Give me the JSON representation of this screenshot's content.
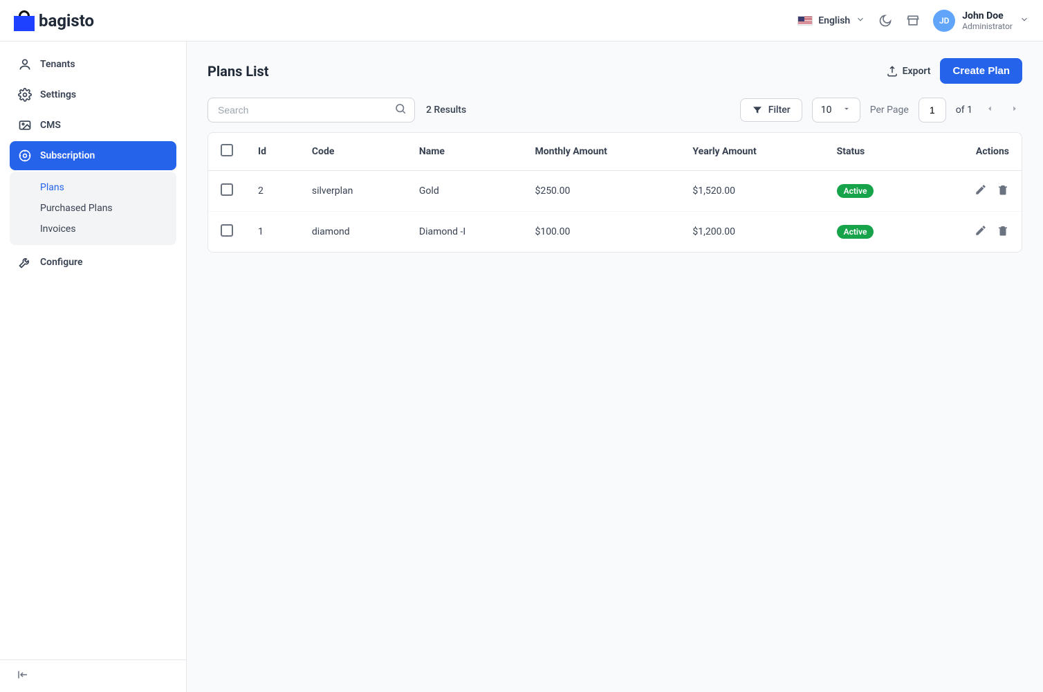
{
  "brand": "bagisto",
  "header": {
    "language": "English",
    "avatar_initials": "JD",
    "user_name": "John Doe",
    "user_role": "Administrator"
  },
  "sidebar": {
    "items": [
      {
        "label": "Tenants"
      },
      {
        "label": "Settings"
      },
      {
        "label": "CMS"
      },
      {
        "label": "Subscription"
      },
      {
        "label": "Configure"
      }
    ],
    "sub": [
      {
        "label": "Plans"
      },
      {
        "label": "Purchased Plans"
      },
      {
        "label": "Invoices"
      }
    ]
  },
  "page": {
    "title": "Plans List",
    "export": "Export",
    "create": "Create Plan"
  },
  "toolbar": {
    "search_placeholder": "Search",
    "results": "2 Results",
    "filter": "Filter",
    "per_page_value": "10",
    "per_page_label": "Per Page",
    "page_value": "1",
    "of_text": "of 1"
  },
  "table": {
    "headers": {
      "id": "Id",
      "code": "Code",
      "name": "Name",
      "monthly": "Monthly Amount",
      "yearly": "Yearly Amount",
      "status": "Status",
      "actions": "Actions"
    },
    "rows": [
      {
        "id": "2",
        "code": "silverplan",
        "name": "Gold",
        "monthly": "$250.00",
        "yearly": "$1,520.00",
        "status": "Active"
      },
      {
        "id": "1",
        "code": "diamond",
        "name": "Diamond -I",
        "monthly": "$100.00",
        "yearly": "$1,200.00",
        "status": "Active"
      }
    ]
  }
}
